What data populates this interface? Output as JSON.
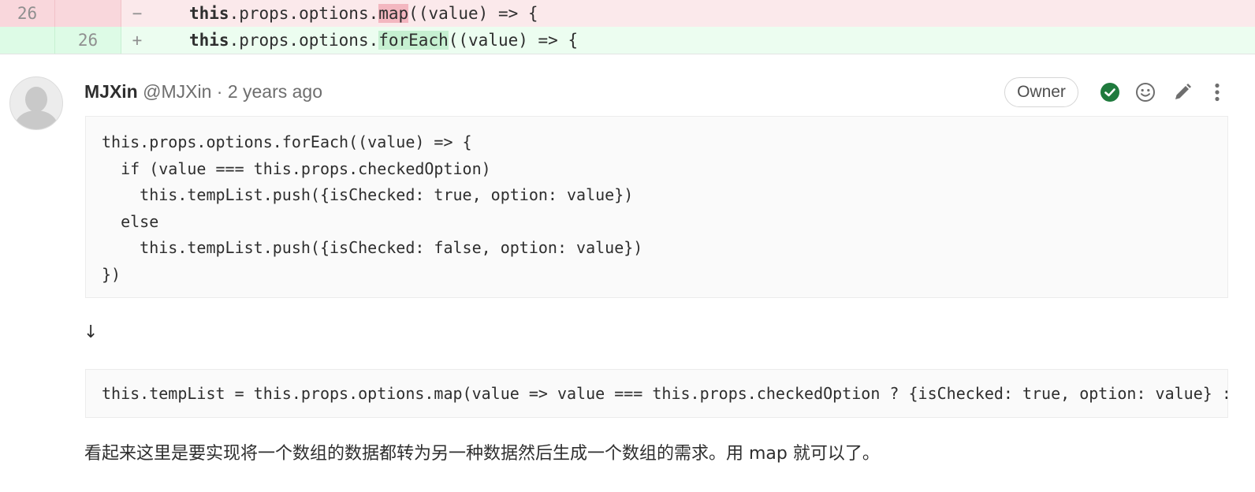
{
  "diff": {
    "old": {
      "line_number": "26",
      "marker": "−",
      "keyword": "this",
      "prefix": ".props.options.",
      "highlight": "map",
      "suffix": "((value) => {"
    },
    "new": {
      "line_number": "26",
      "marker": "+",
      "keyword": "this",
      "prefix": ".props.options.",
      "highlight": "forEach",
      "suffix": "((value) => {"
    }
  },
  "note": {
    "author": "MJXin",
    "handle": "@MJXin",
    "separator": "·",
    "time": "2 years ago",
    "badge": "Owner",
    "actions": {
      "resolve_icon": "check-circle-icon",
      "emoji_icon": "smiley-icon",
      "edit_icon": "pencil-icon",
      "more_icon": "kebab-menu-icon",
      "resolve_color": "#1f7a3d"
    },
    "code1": "this.props.options.forEach((value) => {\n  if (value === this.props.checkedOption)\n    this.tempList.push({isChecked: true, option: value})\n  else\n    this.tempList.push({isChecked: false, option: value})\n})",
    "arrow": "↓",
    "code2": "this.tempList = this.props.options.map(value => value === this.props.checkedOption ? {isChecked: true, option: value} : {isChecked: false, option: value})",
    "body": "看起来这里是要实现将一个数组的数据都转为另一种数据然后生成一个数组的需求。用 map 就可以了。"
  }
}
